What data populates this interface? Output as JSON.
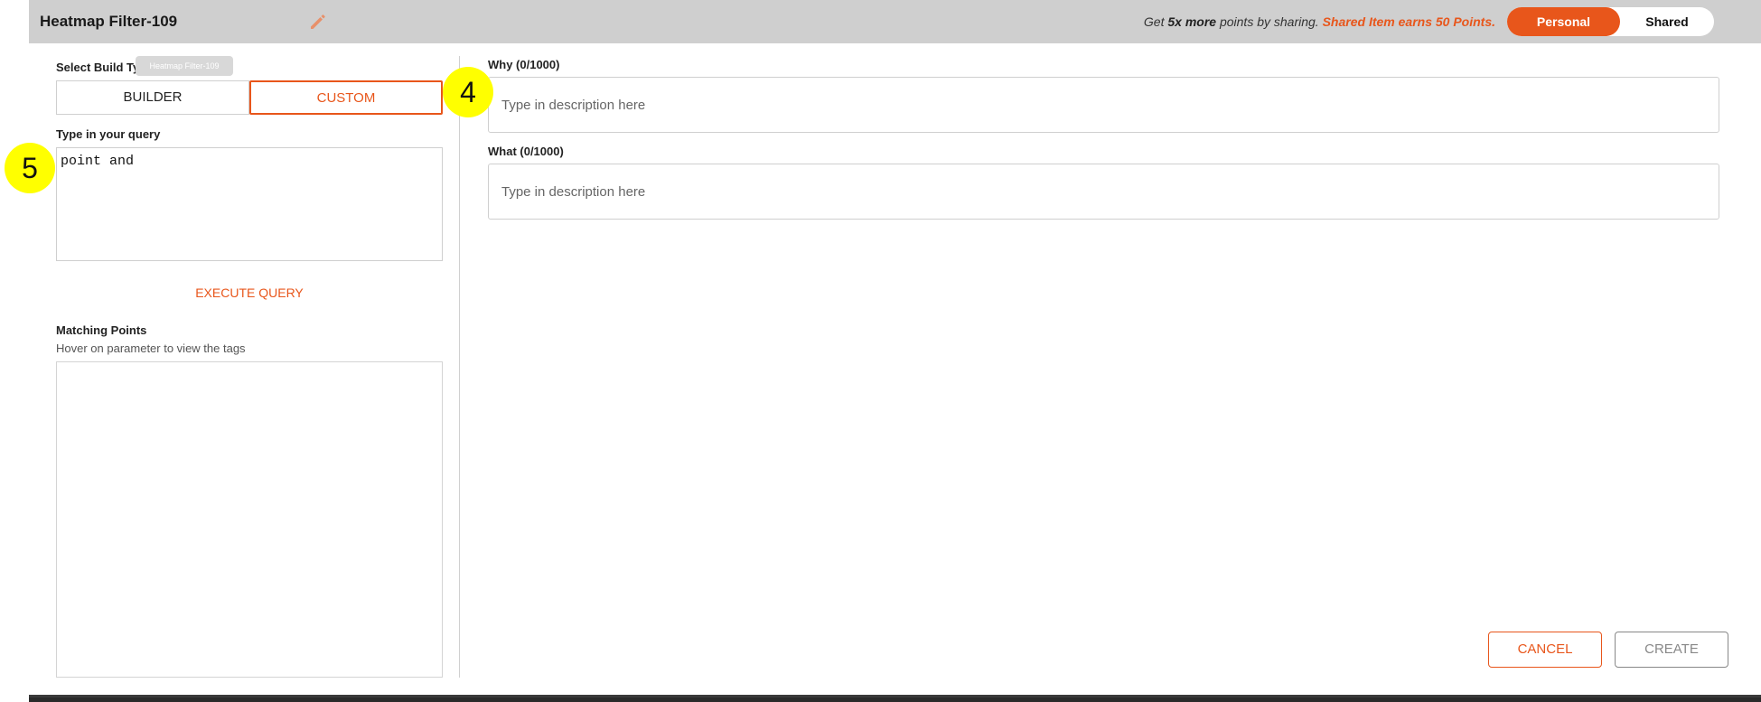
{
  "header": {
    "title": "Heatmap Filter-109",
    "promo_prefix": "Get ",
    "promo_bold": "5x more",
    "promo_middle": " points by sharing. ",
    "promo_accent": "Shared Item earns 50 Points.",
    "toggle": {
      "personal": "Personal",
      "shared": "Shared",
      "selected": "Personal"
    }
  },
  "left": {
    "build_type_label": "Select Build Type",
    "tooltip": "Heatmap Filter-109",
    "builder_label": "BUILDER",
    "custom_label": "CUSTOM",
    "selected_build_type": "CUSTOM",
    "query_label": "Type in your query",
    "query_value": "point and",
    "execute_label": "EXECUTE QUERY",
    "matching_label": "Matching Points",
    "matching_hint": "Hover on parameter to view the tags"
  },
  "right": {
    "why_label": "Why (0/1000)",
    "why_placeholder": "Type in description here",
    "what_label": "What (0/1000)",
    "what_placeholder": "Type in description here"
  },
  "footer": {
    "cancel_label": "CANCEL",
    "create_label": "CREATE"
  },
  "markers": {
    "m4": "4",
    "m5": "5"
  },
  "colors": {
    "accent": "#e8561b",
    "header_bg": "#cfcfcf",
    "marker": "#ffff00"
  }
}
